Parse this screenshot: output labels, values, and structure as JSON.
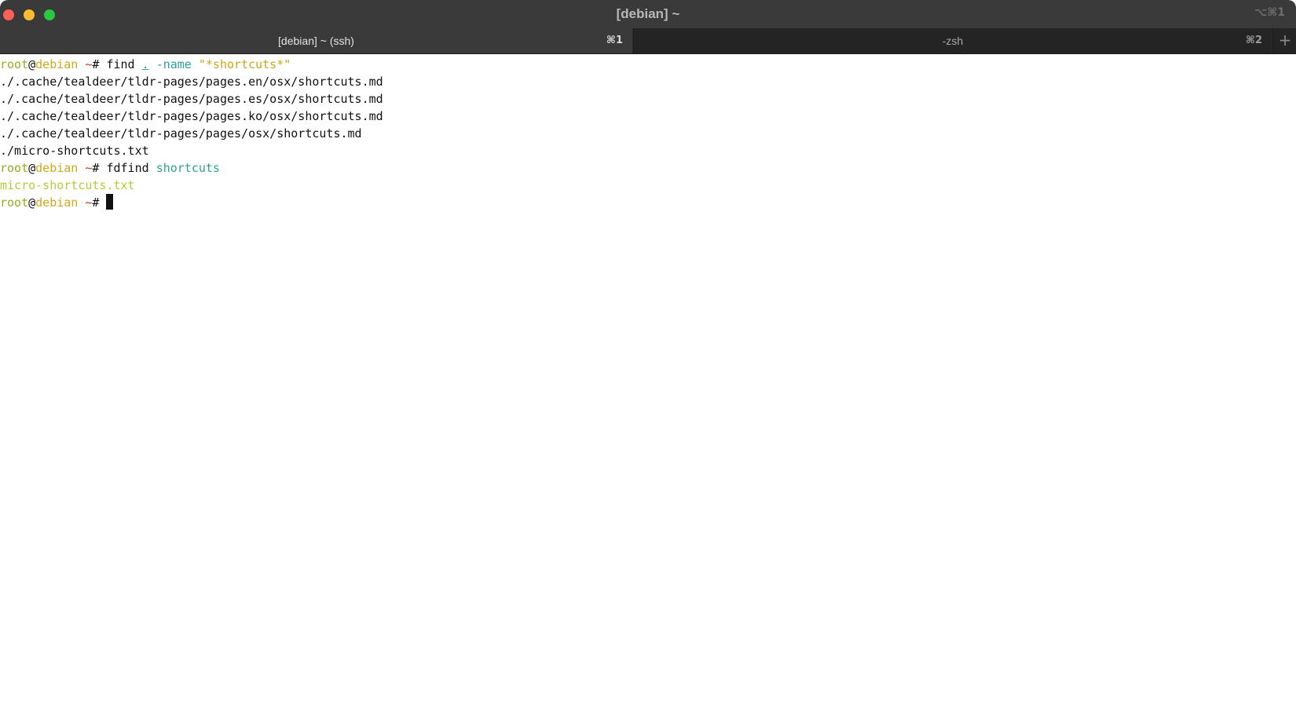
{
  "window": {
    "title": "[debian] ~",
    "shortcut": "⌥⌘1"
  },
  "tabs": [
    {
      "label": "[debian] ~ (ssh)",
      "shortcut": "⌘1",
      "active": true
    },
    {
      "label": "-zsh",
      "shortcut": "⌘2",
      "active": false
    }
  ],
  "new_tab_label": "+",
  "prompt": {
    "user": "root",
    "at": "@",
    "host": "debian",
    "dir": " ~",
    "symbol": "# "
  },
  "commands": [
    {
      "cmd": "find",
      "args": [
        ".",
        "-name"
      ],
      "pattern": "\"*shortcuts*\"",
      "output": [
        "./.cache/tealdeer/tldr-pages/pages.en/osx/shortcuts.md",
        "./.cache/tealdeer/tldr-pages/pages.es/osx/shortcuts.md",
        "./.cache/tealdeer/tldr-pages/pages.ko/osx/shortcuts.md",
        "./.cache/tealdeer/tldr-pages/pages/osx/shortcuts.md",
        "./micro-shortcuts.txt"
      ]
    },
    {
      "cmd": "fdfind",
      "args": [
        "shortcuts"
      ],
      "output": [
        "micro-shortcuts.txt"
      ]
    }
  ],
  "colors": {
    "prompt_user": "#8fb01e",
    "prompt_host": "#d1a71a",
    "prompt_tilde": "#d1342f",
    "argument": "#2aa198",
    "string": "#c9a718",
    "match": "#b9c93a",
    "titlebar": "#3a3a3a"
  }
}
